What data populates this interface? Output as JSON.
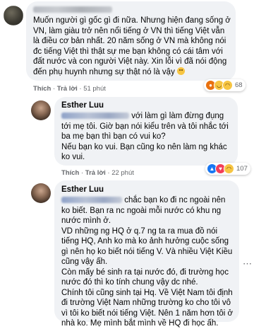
{
  "comments": [
    {
      "author": "",
      "text": "Muốn người gì gốc gì đi nữa. Nhưng hiện đang sống ở VN, làm giàu trở nên nổi tiếng ở VN thì tiếng Việt vẫn là điều cơ bản nhất. 20 năm sống ở VN mà không nói đc tiếng Việt thì thật sự me bạn không có cái tâm với đất nước và con người Việt này. Xin lỗi vì đã nói động đến phụ huynh nhưng sự thật nó là vậy",
      "like": "Thích",
      "reply": "Trả lời",
      "time": "51 phút",
      "reaction_count": "68",
      "reaction_icons": [
        "angry-react-icon",
        "sad-react-icon",
        "haha-react-icon"
      ]
    },
    {
      "author": "Esther Luu",
      "text_after_mention": "với làm gì làm đừng đụng tới mẹ tôi. Giờ bạn nói kiểu trên và tôi nhắc tới ba mẹ bạn thì bạn có vui ko?",
      "text_2": "Nếu bạn ko vui. Bạn cũng ko nên làm ng khác ko vui.",
      "like": "Thích",
      "reply": "Trả lời",
      "time": "22 phút",
      "reaction_count": "107",
      "reaction_icons": [
        "like-react-icon",
        "heart-react-icon",
        "haha-react-icon"
      ]
    },
    {
      "author": "Esther Luu",
      "text_after_mention": "chắc bạn ko đi nc ngoài nên ko biết. Bạn ra nc ngoài mỗi nước có khu ng nước mình ở.",
      "text_2": "VD những ng HQ ở q.7 ng ta ra mua đồ nói tiếng HQ, Anh ko mà ko ảnh hưởng cuộc sống gì nên họ ko biết nói tiếng V. Và nhiều Việt Kiều cũng vậy ấh.",
      "text_3": "Còn mấy bé sinh ra tại nước đó, đi trường học nước đó thì ko tính chung vậy dc nhé.",
      "text_4": "Chính tôi cũng sinh tại Hq. Về Việt Nam tôi định đi trường Việt Nam những trường ko cho tôi vô vì tôi ko biết nói tiếng Việt. Nên 1 năm hơn tôi ở nhà ko. Mẹ mình bắt mình về HQ đi học ấh."
    }
  ],
  "colors": {
    "bubble": "#f0f2f5",
    "meta": "#65676b",
    "like_blue": "#1877f2",
    "heart_red": "#f33e58",
    "haha_yellow": "#f7c542",
    "angry_orange": "#e9710f"
  }
}
